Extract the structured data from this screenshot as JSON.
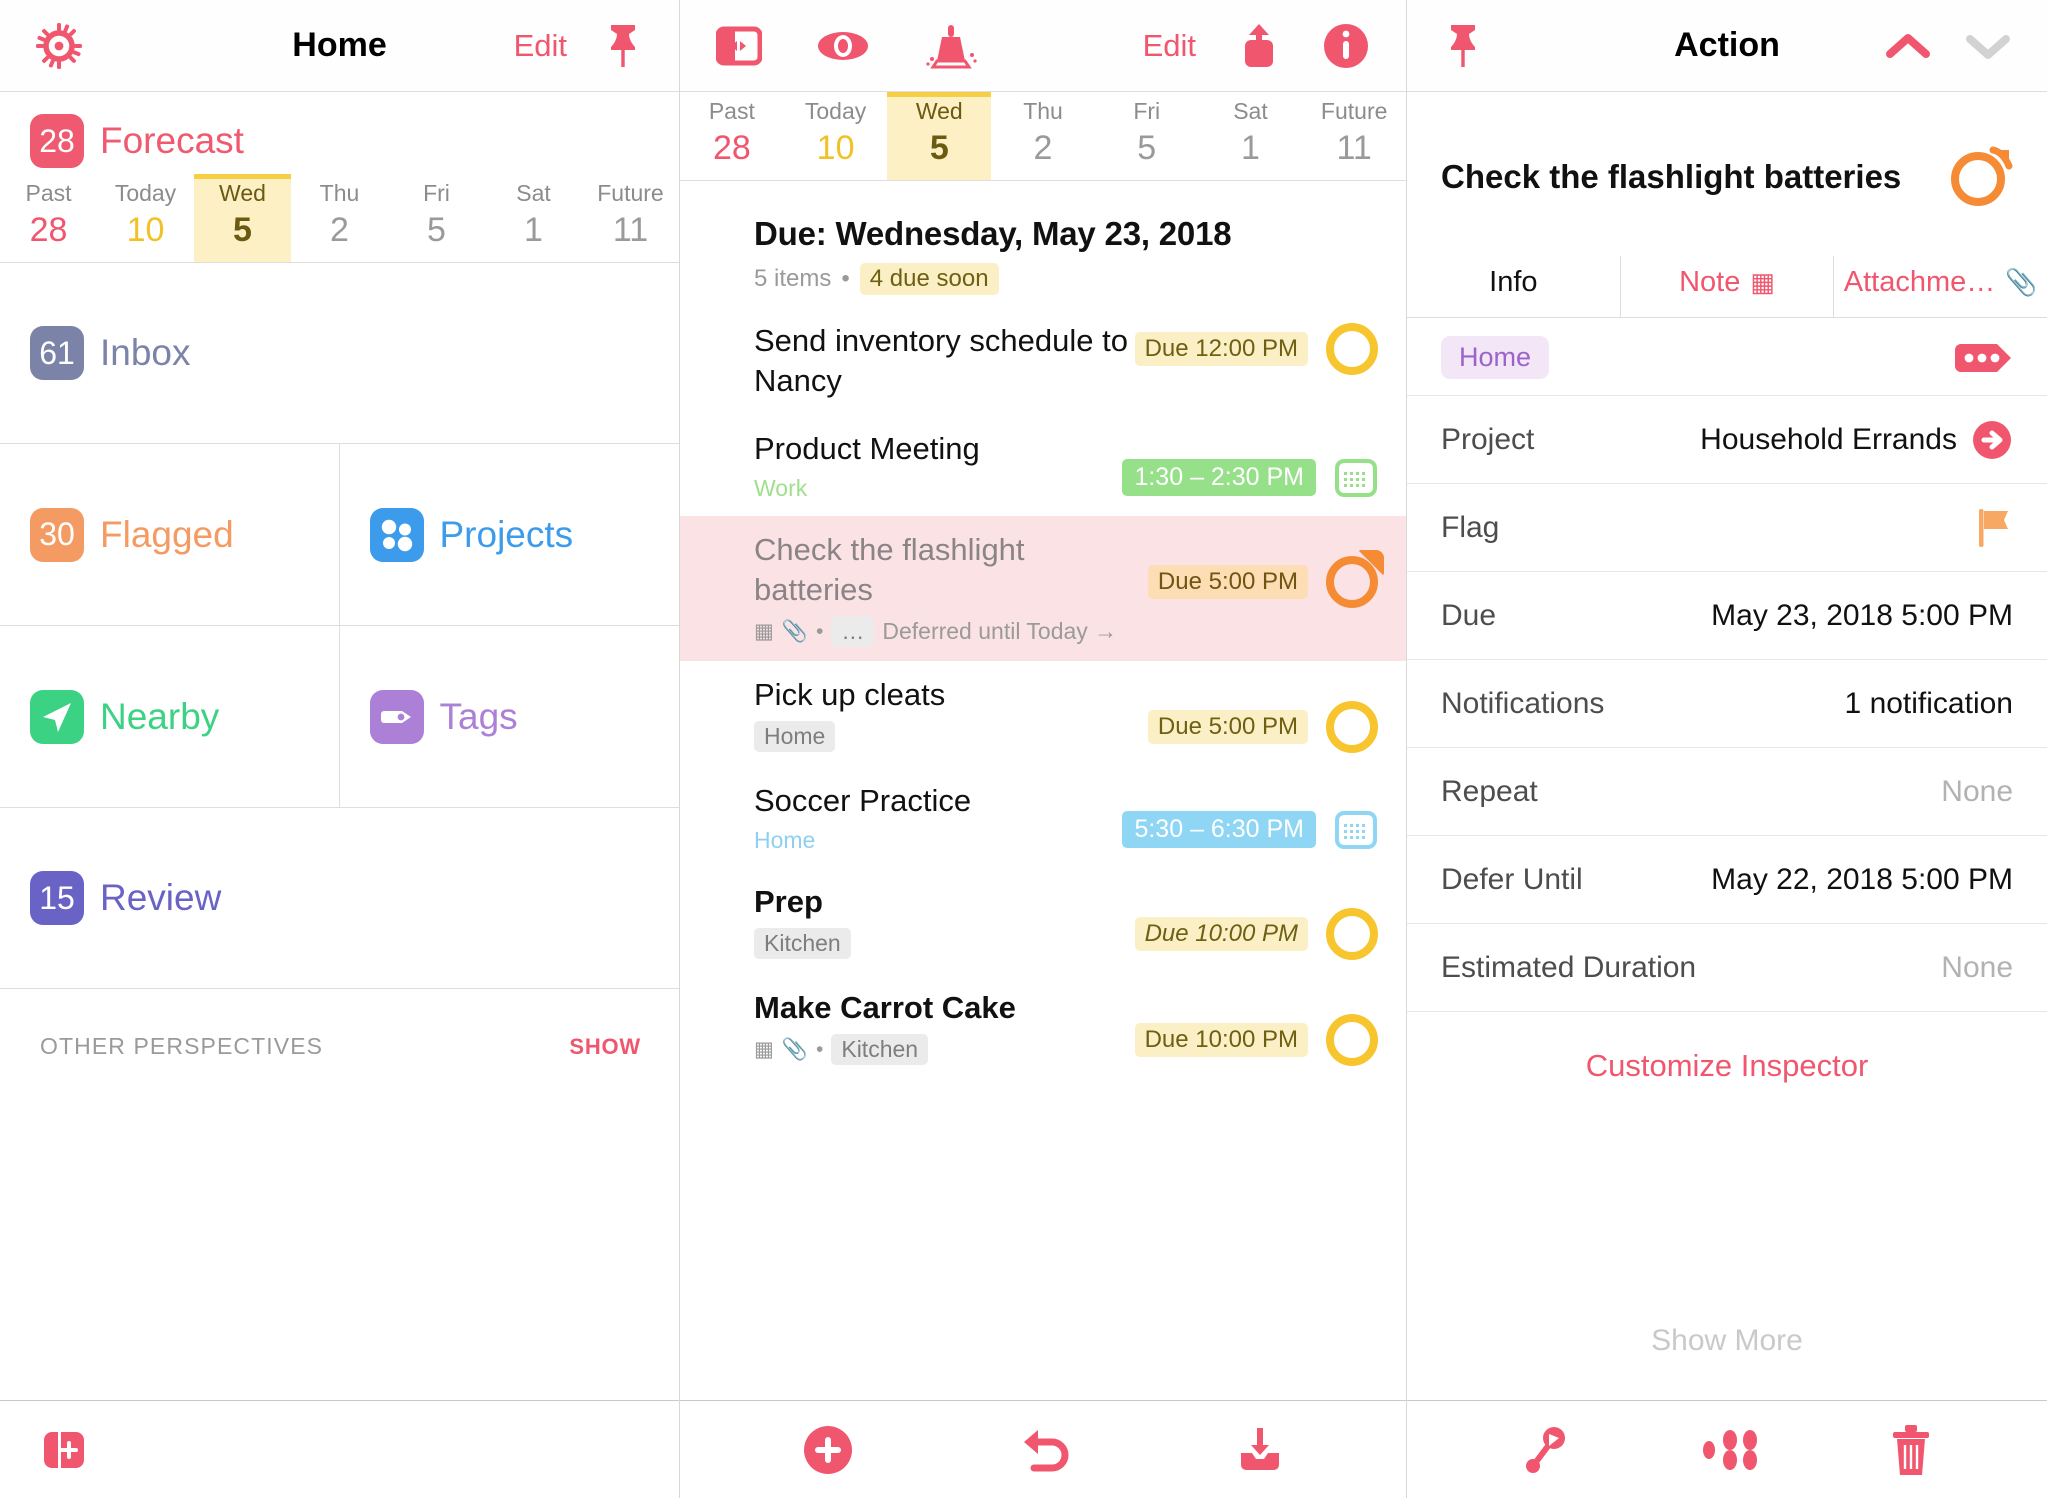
{
  "sidebar": {
    "header": {
      "title": "Home",
      "edit_label": "Edit",
      "gear_icon": "gear-icon",
      "pin_icon": "pin-icon"
    },
    "forecast": {
      "count": "28",
      "label": "Forecast",
      "color": "#ef5a70",
      "days": [
        {
          "name": "Past",
          "num": "28",
          "state": "past"
        },
        {
          "name": "Today",
          "num": "10",
          "state": "today"
        },
        {
          "name": "Wed",
          "num": "5",
          "state": "selected"
        },
        {
          "name": "Thu",
          "num": "2",
          "state": "normal"
        },
        {
          "name": "Fri",
          "num": "5",
          "state": "normal"
        },
        {
          "name": "Sat",
          "num": "1",
          "state": "normal"
        },
        {
          "name": "Future",
          "num": "11",
          "state": "normal"
        }
      ]
    },
    "inbox": {
      "count": "61",
      "label": "Inbox",
      "color": "#7b83a8",
      "text_color": "#7b83a8"
    },
    "tiles": [
      {
        "label": "Flagged",
        "count": "30",
        "color": "#f49b63",
        "text_color": "#f49b63",
        "icon": "count-badge"
      },
      {
        "label": "Projects",
        "count": "",
        "color": "#3d9bec",
        "text_color": "#3d9bec",
        "icon": "projects-icon"
      },
      {
        "label": "Nearby",
        "count": "",
        "color": "#3bd283",
        "text_color": "#3bd283",
        "icon": "nearby-arrow-icon"
      },
      {
        "label": "Tags",
        "count": "",
        "color": "#ad80d8",
        "text_color": "#ad80d8",
        "icon": "tag-icon"
      }
    ],
    "review": {
      "count": "15",
      "label": "Review",
      "color": "#6a63c6",
      "text_color": "#6a63c6"
    },
    "other_perspectives": {
      "title": "OTHER PERSPECTIVES",
      "show_label": "SHOW"
    },
    "bottom_toolbar": [
      {
        "icon": "new-perspective-icon"
      }
    ]
  },
  "list": {
    "toolbar": {
      "sidebar_toggle_icon": "sidebar-toggle-icon",
      "view_icon": "eye-icon",
      "cleanup_icon": "broom-icon",
      "edit_label": "Edit",
      "share_icon": "share-icon",
      "info_icon": "info-icon"
    },
    "days": [
      {
        "name": "Past",
        "num": "28",
        "state": "past"
      },
      {
        "name": "Today",
        "num": "10",
        "state": "today"
      },
      {
        "name": "Wed",
        "num": "5",
        "state": "selected"
      },
      {
        "name": "Thu",
        "num": "2",
        "state": "normal"
      },
      {
        "name": "Fri",
        "num": "5",
        "state": "normal"
      },
      {
        "name": "Sat",
        "num": "1",
        "state": "normal"
      },
      {
        "name": "Future",
        "num": "11",
        "state": "normal"
      }
    ],
    "header": {
      "title": "Due: Wednesday, May 23, 2018",
      "items_text": "5 items",
      "separator": "•",
      "due_soon": "4 due soon"
    },
    "tasks": [
      {
        "title": "Send inventory schedule to Nancy",
        "tag": "",
        "tag_style": "",
        "badge": "Due 12:00 PM",
        "badge_style": "due-yellow",
        "marker": "circle-yellow",
        "selected": false,
        "icons": ""
      },
      {
        "title": "Product Meeting",
        "tag": "Work",
        "tag_style": "tag-work",
        "badge": "1:30 – 2:30 PM",
        "badge_style": "due-green",
        "marker": "calendar-green",
        "selected": false,
        "icons": ""
      },
      {
        "title": "Check the flashlight batteries",
        "tag": "Deferred until Today  →",
        "tag_style": "tag-plain",
        "badge": "Due 5:00 PM",
        "badge_style": "due-orange",
        "marker": "circle-orange-flagged",
        "selected": true,
        "icons": "note-attachment-more"
      },
      {
        "title": "Pick up cleats",
        "tag": "Home",
        "tag_style": "tag-box",
        "badge": "Due 5:00 PM",
        "badge_style": "due-yellow",
        "marker": "circle-yellow",
        "selected": false,
        "icons": ""
      },
      {
        "title": "Soccer Practice",
        "tag": "Home",
        "tag_style": "tag-home-blue",
        "badge": "5:30 – 6:30 PM",
        "badge_style": "due-blue",
        "marker": "calendar-blue",
        "selected": false,
        "icons": ""
      },
      {
        "title": "Prep",
        "tag": "Kitchen",
        "tag_style": "tag-box",
        "badge": "Due 10:00 PM",
        "badge_style": "due-yellow",
        "marker": "circle-yellow",
        "selected": false,
        "icons": ""
      },
      {
        "title": "Make Carrot Cake",
        "tag": "Kitchen",
        "tag_style": "tag-box",
        "badge": "Due 10:00 PM",
        "badge_style": "due-yellow",
        "marker": "circle-yellow",
        "selected": false,
        "icons": "note-attachment"
      }
    ],
    "bottom_toolbar": [
      {
        "icon": "add-plus-icon"
      },
      {
        "icon": "undo-icon"
      },
      {
        "icon": "inbox-in-icon"
      }
    ]
  },
  "inspector": {
    "toolbar": {
      "pin_icon": "pin-icon",
      "title": "Action",
      "up_icon": "chevron-up-icon",
      "down_icon": "chevron-down-icon"
    },
    "task_title": "Check the flashlight batteries",
    "status_marker": "circle-orange-flagged",
    "tabs": [
      {
        "label": "Info",
        "active": true,
        "icon": ""
      },
      {
        "label": "Note",
        "active": false,
        "icon": "note-icon"
      },
      {
        "label": "Attachme…",
        "active": false,
        "icon": "paperclip-icon"
      }
    ],
    "tag": "Home",
    "tag_more_icon": "tag-ellipsis-icon",
    "rows": [
      {
        "key": "Project",
        "value": "Household Errands",
        "style": "normal",
        "trailing": "go-arrow-icon"
      },
      {
        "key": "Flag",
        "value": "",
        "style": "normal",
        "trailing": "flag-icon"
      },
      {
        "key": "Due",
        "value": "May 23, 2018  5:00 PM",
        "style": "normal",
        "trailing": ""
      },
      {
        "key": "Notifications",
        "value": "1 notification",
        "style": "normal",
        "trailing": ""
      },
      {
        "key": "Repeat",
        "value": "None",
        "style": "none",
        "trailing": ""
      },
      {
        "key": "Defer Until",
        "value": "May 22, 2018  5:00 PM",
        "style": "normal",
        "trailing": ""
      },
      {
        "key": "Estimated Duration",
        "value": "None",
        "style": "none",
        "trailing": ""
      }
    ],
    "customize_label": "Customize Inspector",
    "show_more_label": "Show More",
    "bottom_toolbar": [
      {
        "icon": "tag-assign-icon"
      },
      {
        "icon": "flag-group-icon"
      },
      {
        "icon": "trash-icon"
      }
    ]
  },
  "colors": {
    "accent": "#f0566e",
    "due_soon_yellow": "#f7c52e",
    "overdue_orange": "#f58b35",
    "calendar_green": "#97e08a",
    "calendar_blue": "#8fd6f5"
  }
}
